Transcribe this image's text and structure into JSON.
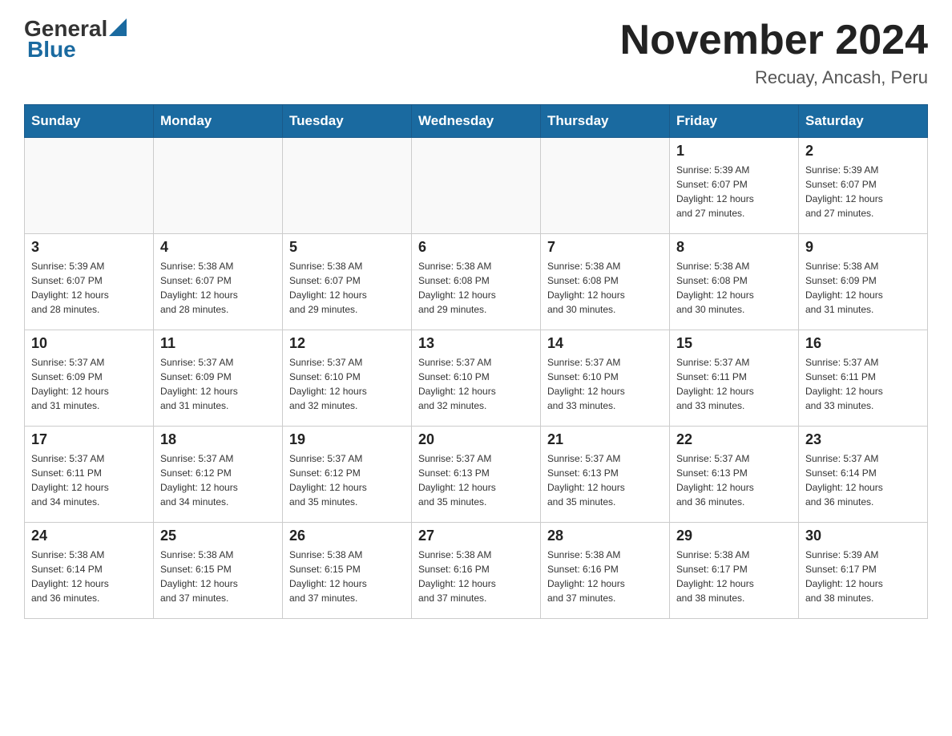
{
  "header": {
    "logo": {
      "general": "General",
      "blue": "Blue"
    },
    "title": "November 2024",
    "subtitle": "Recuay, Ancash, Peru"
  },
  "days_of_week": [
    "Sunday",
    "Monday",
    "Tuesday",
    "Wednesday",
    "Thursday",
    "Friday",
    "Saturday"
  ],
  "weeks": [
    [
      {
        "day": "",
        "info": ""
      },
      {
        "day": "",
        "info": ""
      },
      {
        "day": "",
        "info": ""
      },
      {
        "day": "",
        "info": ""
      },
      {
        "day": "",
        "info": ""
      },
      {
        "day": "1",
        "info": "Sunrise: 5:39 AM\nSunset: 6:07 PM\nDaylight: 12 hours\nand 27 minutes."
      },
      {
        "day": "2",
        "info": "Sunrise: 5:39 AM\nSunset: 6:07 PM\nDaylight: 12 hours\nand 27 minutes."
      }
    ],
    [
      {
        "day": "3",
        "info": "Sunrise: 5:39 AM\nSunset: 6:07 PM\nDaylight: 12 hours\nand 28 minutes."
      },
      {
        "day": "4",
        "info": "Sunrise: 5:38 AM\nSunset: 6:07 PM\nDaylight: 12 hours\nand 28 minutes."
      },
      {
        "day": "5",
        "info": "Sunrise: 5:38 AM\nSunset: 6:07 PM\nDaylight: 12 hours\nand 29 minutes."
      },
      {
        "day": "6",
        "info": "Sunrise: 5:38 AM\nSunset: 6:08 PM\nDaylight: 12 hours\nand 29 minutes."
      },
      {
        "day": "7",
        "info": "Sunrise: 5:38 AM\nSunset: 6:08 PM\nDaylight: 12 hours\nand 30 minutes."
      },
      {
        "day": "8",
        "info": "Sunrise: 5:38 AM\nSunset: 6:08 PM\nDaylight: 12 hours\nand 30 minutes."
      },
      {
        "day": "9",
        "info": "Sunrise: 5:38 AM\nSunset: 6:09 PM\nDaylight: 12 hours\nand 31 minutes."
      }
    ],
    [
      {
        "day": "10",
        "info": "Sunrise: 5:37 AM\nSunset: 6:09 PM\nDaylight: 12 hours\nand 31 minutes."
      },
      {
        "day": "11",
        "info": "Sunrise: 5:37 AM\nSunset: 6:09 PM\nDaylight: 12 hours\nand 31 minutes."
      },
      {
        "day": "12",
        "info": "Sunrise: 5:37 AM\nSunset: 6:10 PM\nDaylight: 12 hours\nand 32 minutes."
      },
      {
        "day": "13",
        "info": "Sunrise: 5:37 AM\nSunset: 6:10 PM\nDaylight: 12 hours\nand 32 minutes."
      },
      {
        "day": "14",
        "info": "Sunrise: 5:37 AM\nSunset: 6:10 PM\nDaylight: 12 hours\nand 33 minutes."
      },
      {
        "day": "15",
        "info": "Sunrise: 5:37 AM\nSunset: 6:11 PM\nDaylight: 12 hours\nand 33 minutes."
      },
      {
        "day": "16",
        "info": "Sunrise: 5:37 AM\nSunset: 6:11 PM\nDaylight: 12 hours\nand 33 minutes."
      }
    ],
    [
      {
        "day": "17",
        "info": "Sunrise: 5:37 AM\nSunset: 6:11 PM\nDaylight: 12 hours\nand 34 minutes."
      },
      {
        "day": "18",
        "info": "Sunrise: 5:37 AM\nSunset: 6:12 PM\nDaylight: 12 hours\nand 34 minutes."
      },
      {
        "day": "19",
        "info": "Sunrise: 5:37 AM\nSunset: 6:12 PM\nDaylight: 12 hours\nand 35 minutes."
      },
      {
        "day": "20",
        "info": "Sunrise: 5:37 AM\nSunset: 6:13 PM\nDaylight: 12 hours\nand 35 minutes."
      },
      {
        "day": "21",
        "info": "Sunrise: 5:37 AM\nSunset: 6:13 PM\nDaylight: 12 hours\nand 35 minutes."
      },
      {
        "day": "22",
        "info": "Sunrise: 5:37 AM\nSunset: 6:13 PM\nDaylight: 12 hours\nand 36 minutes."
      },
      {
        "day": "23",
        "info": "Sunrise: 5:37 AM\nSunset: 6:14 PM\nDaylight: 12 hours\nand 36 minutes."
      }
    ],
    [
      {
        "day": "24",
        "info": "Sunrise: 5:38 AM\nSunset: 6:14 PM\nDaylight: 12 hours\nand 36 minutes."
      },
      {
        "day": "25",
        "info": "Sunrise: 5:38 AM\nSunset: 6:15 PM\nDaylight: 12 hours\nand 37 minutes."
      },
      {
        "day": "26",
        "info": "Sunrise: 5:38 AM\nSunset: 6:15 PM\nDaylight: 12 hours\nand 37 minutes."
      },
      {
        "day": "27",
        "info": "Sunrise: 5:38 AM\nSunset: 6:16 PM\nDaylight: 12 hours\nand 37 minutes."
      },
      {
        "day": "28",
        "info": "Sunrise: 5:38 AM\nSunset: 6:16 PM\nDaylight: 12 hours\nand 37 minutes."
      },
      {
        "day": "29",
        "info": "Sunrise: 5:38 AM\nSunset: 6:17 PM\nDaylight: 12 hours\nand 38 minutes."
      },
      {
        "day": "30",
        "info": "Sunrise: 5:39 AM\nSunset: 6:17 PM\nDaylight: 12 hours\nand 38 minutes."
      }
    ]
  ],
  "colors": {
    "header_bg": "#1a6aa0",
    "logo_blue": "#1a6aa0"
  }
}
